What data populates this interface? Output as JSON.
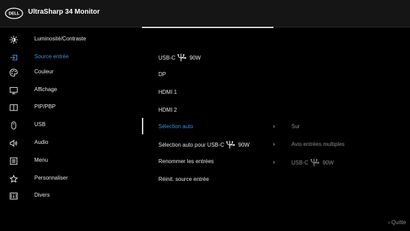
{
  "header": {
    "title": "UltraSharp 34 Monitor",
    "logo_text": "DELL"
  },
  "menu": {
    "items": [
      {
        "label": "Luminosité/Contraste",
        "icon": "brightness-icon"
      },
      {
        "label": "Source entrée",
        "icon": "input-source-icon"
      },
      {
        "label": "Couleur",
        "icon": "color-palette-icon"
      },
      {
        "label": "Affichage",
        "icon": "display-icon"
      },
      {
        "label": "PIP/PBP",
        "icon": "pip-pbp-icon"
      },
      {
        "label": "USB",
        "icon": "usb-mouse-icon"
      },
      {
        "label": "Audio",
        "icon": "speaker-icon"
      },
      {
        "label": "Menu",
        "icon": "menu-icon"
      },
      {
        "label": "Personnaliser",
        "icon": "star-icon"
      },
      {
        "label": "Divers",
        "icon": "info-icon"
      }
    ],
    "active_index": 1
  },
  "submenu": {
    "items": [
      {
        "label": "USB-C",
        "suffix": "90W",
        "has_power_icon": true
      },
      {
        "label": "DP"
      },
      {
        "label": "HDMI 1"
      },
      {
        "label": "HDMI 2"
      },
      {
        "label": "Sélection auto",
        "value": "Sur",
        "has_arrow": true
      },
      {
        "label": "Sélection auto pour USB-C",
        "suffix": "90W",
        "has_power_icon": true,
        "value": "Avis entrées multiples",
        "has_arrow": true
      },
      {
        "label": "Renommer les entrées",
        "value": "USB-C",
        "value_suffix": "90W",
        "value_has_power_icon": true,
        "has_arrow": true
      },
      {
        "label": "Réinit. source entrée"
      }
    ],
    "selected_index": 4,
    "arrow_glyph": "›"
  },
  "footer": {
    "exit_label": "Quitte",
    "exit_glyph": "‹"
  },
  "colors": {
    "accent": "#3d8fe0",
    "background": "#000000",
    "header": "#151515",
    "text": "#e6e6e6",
    "muted": "#8a8a8a"
  }
}
